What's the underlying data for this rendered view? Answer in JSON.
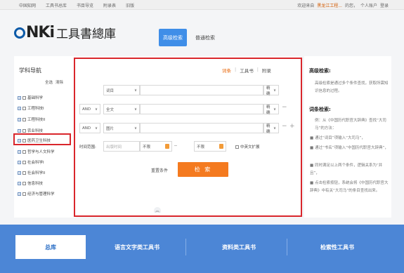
{
  "topbar": {
    "nav": [
      "中国知网",
      "工具书总库",
      "书目导览",
      "附录表",
      "旧版"
    ],
    "welcome": "欢迎来自",
    "org": "黑龙江工程...",
    "greet": "的您，",
    "personal": "个人账户",
    "login": "登录"
  },
  "logo": {
    "cnki": "cnki",
    "title": "工具書總庫"
  },
  "search_tabs": {
    "advanced": "高级检索",
    "normal": "普通检索"
  },
  "subject_nav": {
    "title": "学科导航",
    "select_all": "全选",
    "clear": "清除",
    "items": [
      "基础科学",
      "工程科技I",
      "工程科技II",
      "农业科技",
      "医药卫生科技",
      "哲学与人文科学",
      "社会科学I",
      "社会科学II",
      "信息科技",
      "经济与管理科学"
    ]
  },
  "scope_tabs": {
    "entry": "词条",
    "book": "工具书",
    "appendix": "附录"
  },
  "rows": [
    {
      "logic": "",
      "field": "词目",
      "match": "精确"
    },
    {
      "logic": "AND",
      "field": "全文",
      "match": "精确"
    },
    {
      "logic": "AND",
      "field": "图片",
      "match": "精确"
    }
  ],
  "time": {
    "label": "时间范围:",
    "field": "出版时间",
    "from": "不限",
    "to": "不限",
    "range_sep": "--",
    "cn_lang": "中英文扩展"
  },
  "buttons": {
    "reset": "重置条件",
    "search": "检 索"
  },
  "help": {
    "adv_title": "高级检索:",
    "adv_text": "高级检索是通过多个条件查找，获取所需知识信息的过程。",
    "entry_title": "词条检索:",
    "entry_intro": "例：从《中国历代职官大辞典》查找“大司马”的方法：",
    "bullets": [
      "■ 通过“词目”项输入“大司马”，",
      "■ 通过“书名”项输入“中国历代职官大辞典”，",
      "■ 同时满足以上两个条件，逻辑关系为“并且”，",
      "■ 点击检索按钮，系统会将《中国历代职官大辞典》中有关“大司马”的条目查找出来。"
    ]
  },
  "bottom_tabs": [
    "总库",
    "语言文字类工具书",
    "资料类工具书",
    "检索性工具书"
  ]
}
